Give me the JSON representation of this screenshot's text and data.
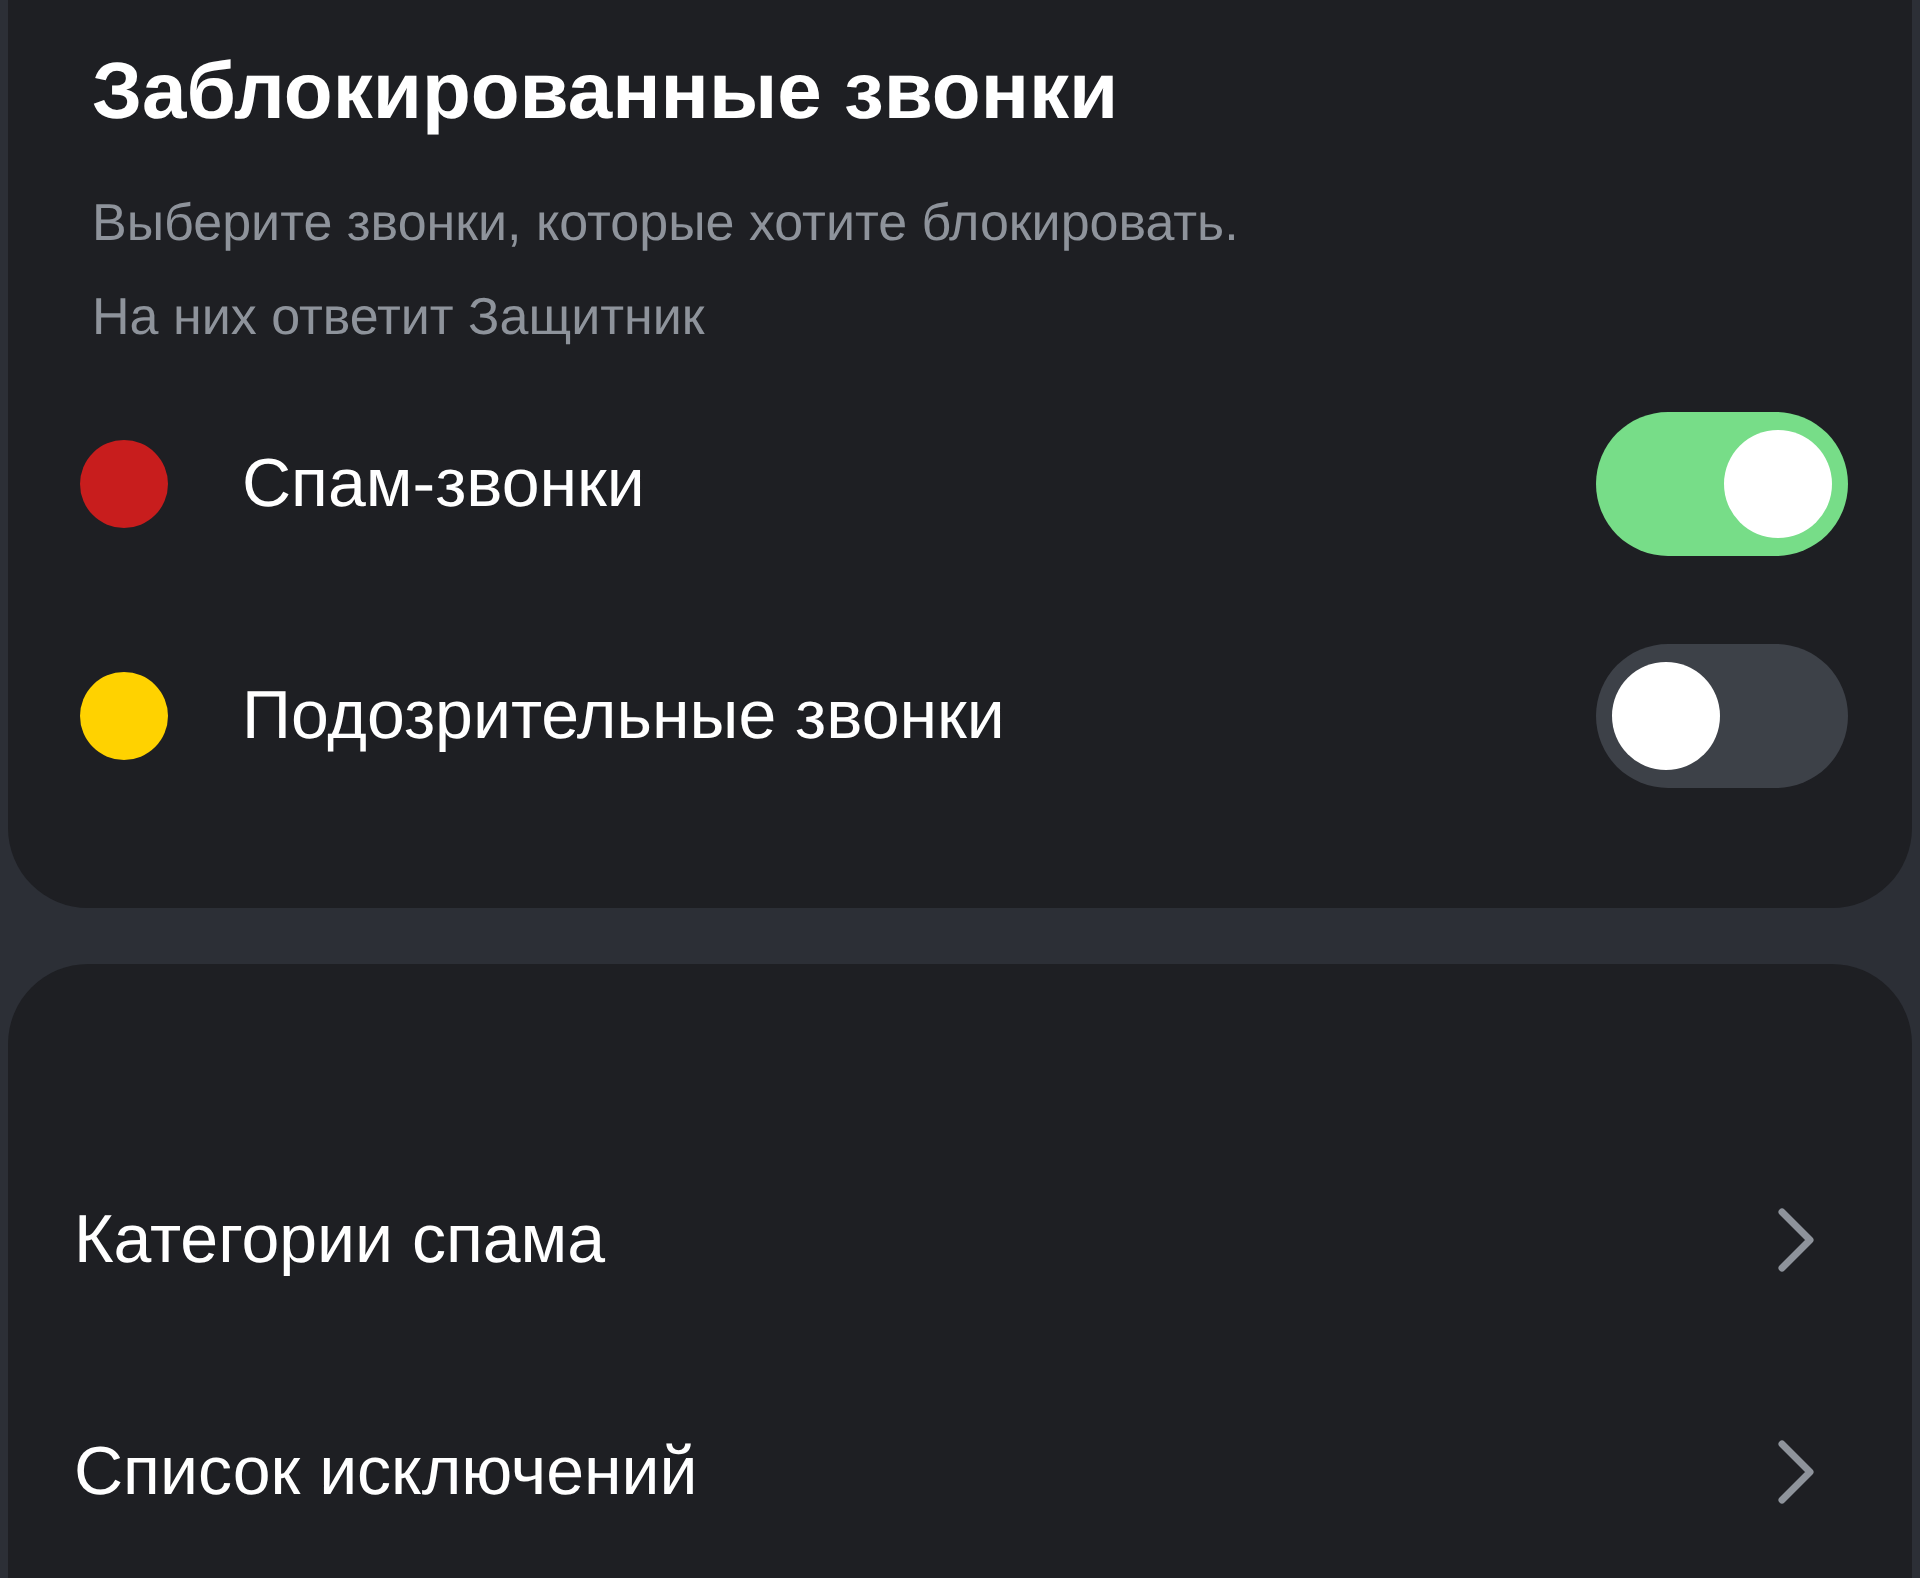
{
  "blocked_calls": {
    "title": "Заблокированные звонки",
    "description_lines": [
      "Выберите звонки, которые хотите блокировать.",
      "На них ответит Защитник"
    ],
    "options": [
      {
        "label": "Спам-звонки",
        "color": "#c81d1d",
        "on": true
      },
      {
        "label": "Подозрительные звонки",
        "color": "#ffd200",
        "on": false
      }
    ]
  },
  "settings": {
    "items": [
      {
        "label": "Категории спама"
      },
      {
        "label": "Список исключений"
      }
    ]
  }
}
